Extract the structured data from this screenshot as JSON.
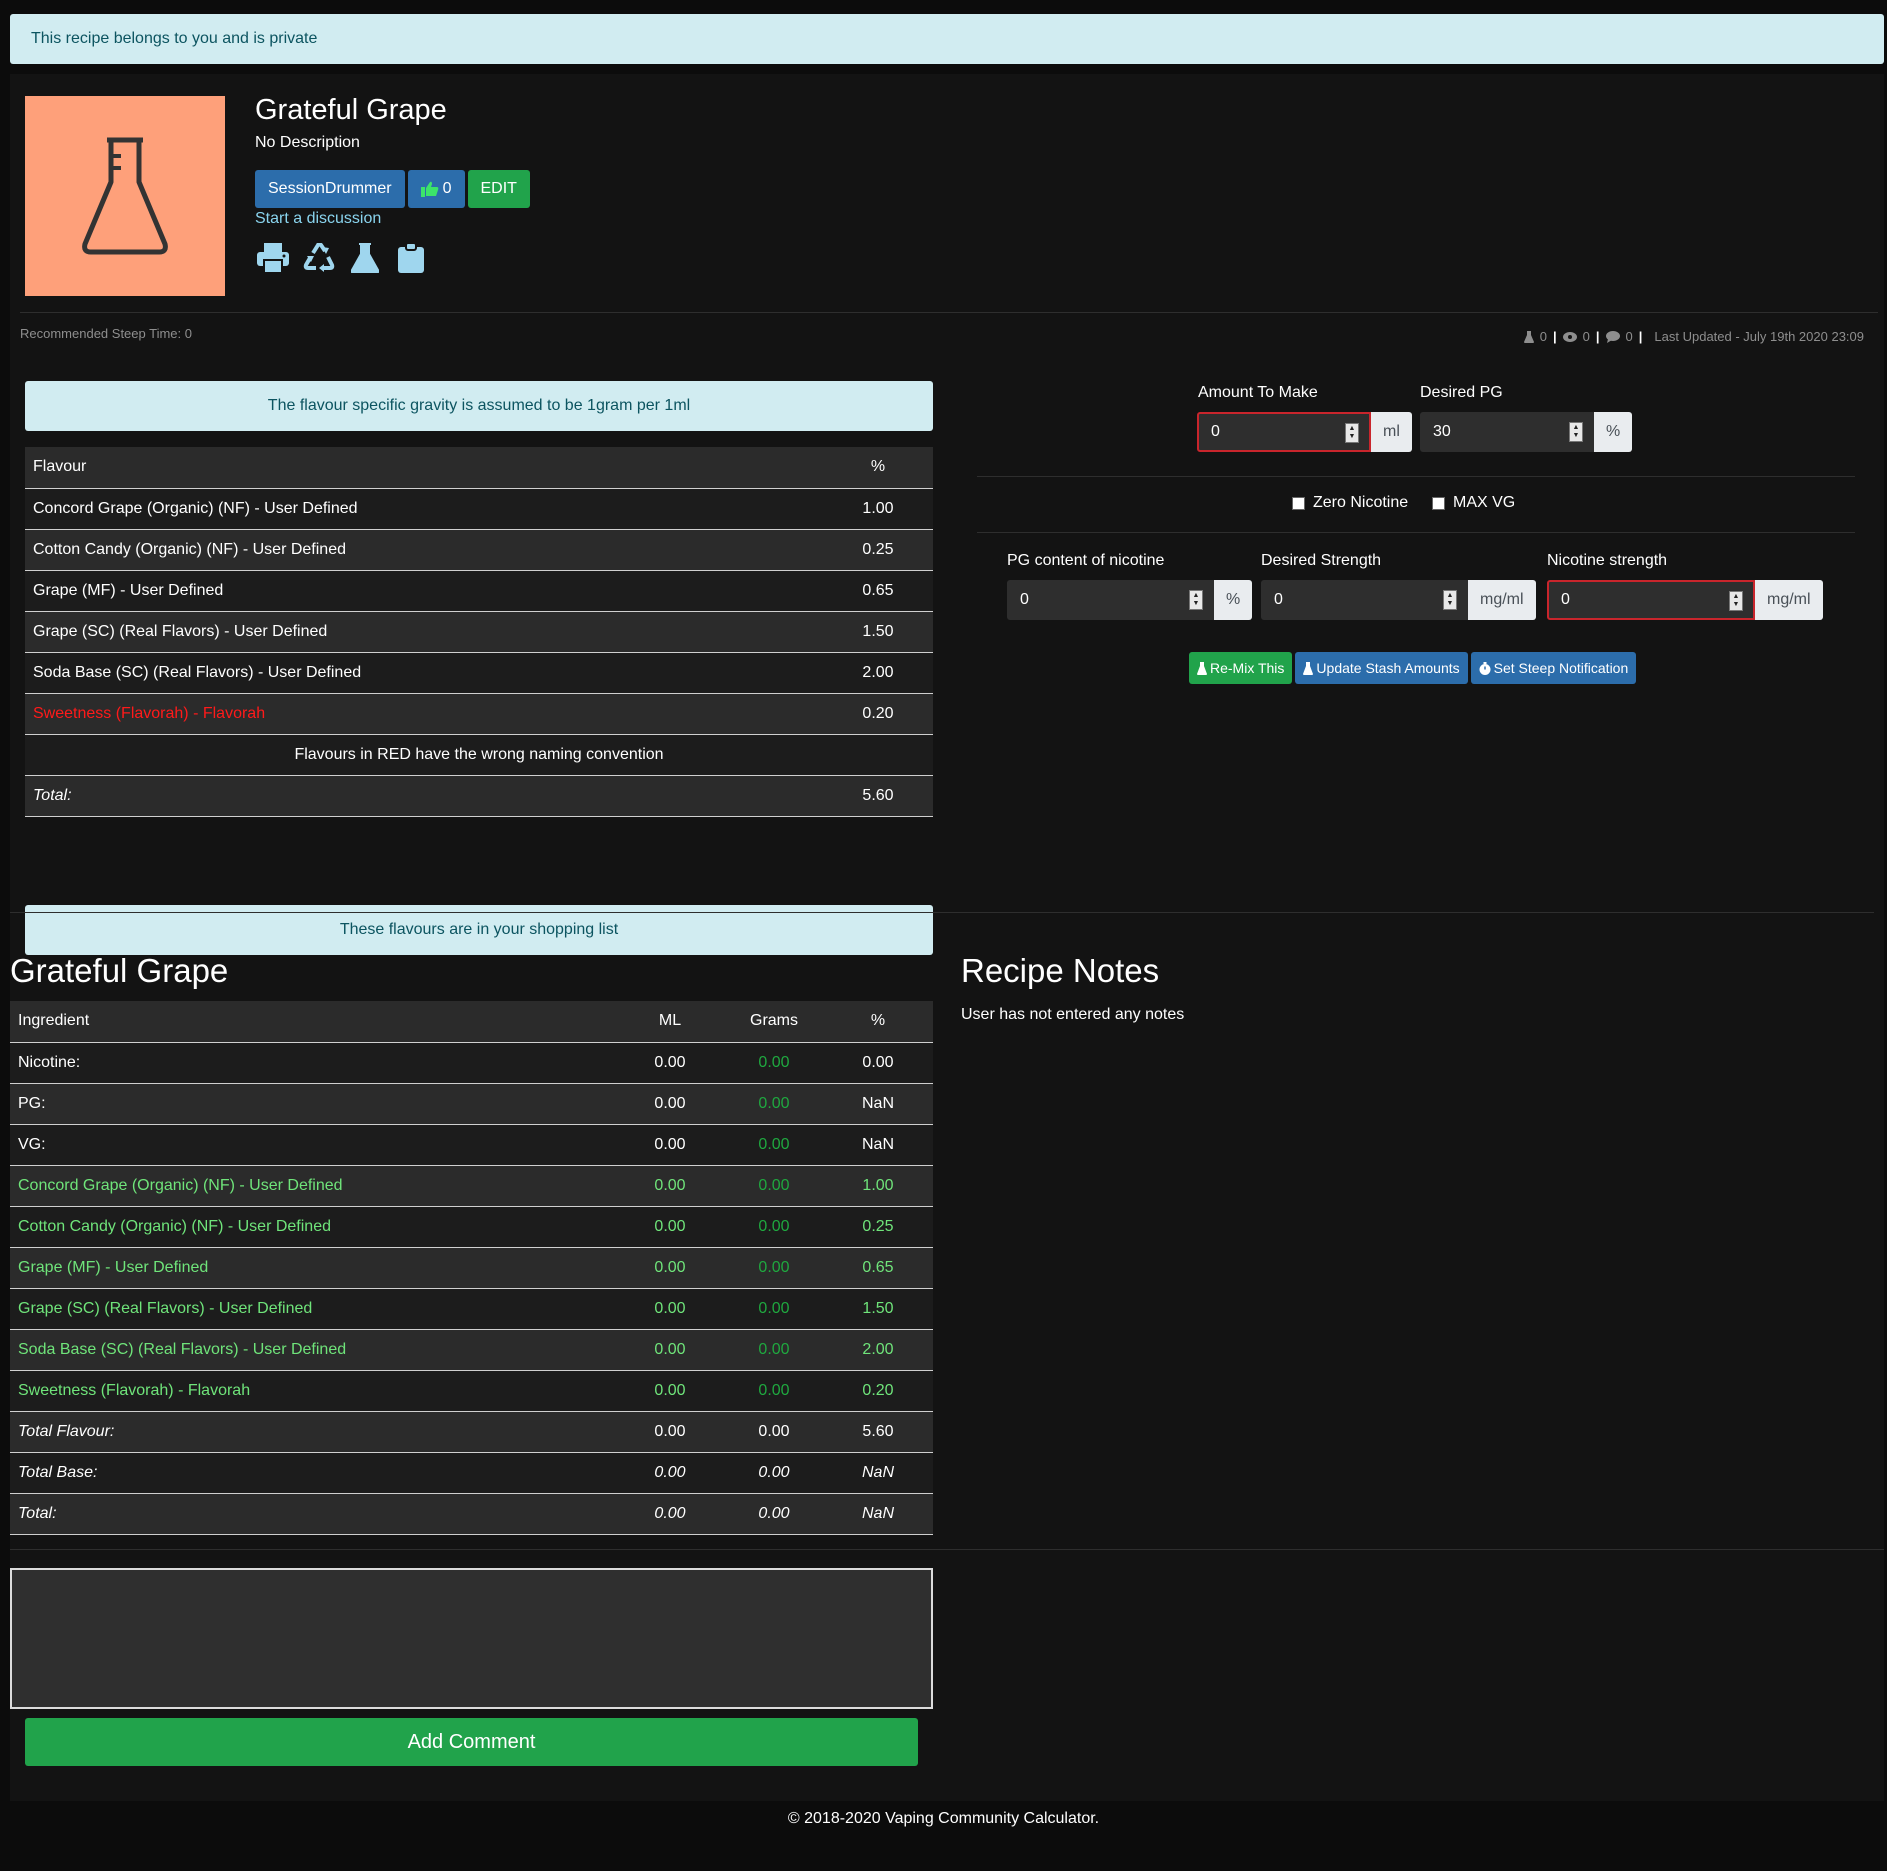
{
  "privacy_notice": "This recipe belongs to you and is private",
  "recipe": {
    "title": "Grateful Grape",
    "description": "No Description",
    "author": "SessionDrummer",
    "likes": "0",
    "edit_label": "EDIT",
    "discussion_link": "Start a discussion",
    "steep_time": "Recommended Steep Time: 0",
    "stats": {
      "mixes": "0",
      "views": "0",
      "comments": "0",
      "last_updated": "Last Updated - July 19th 2020 23:09"
    }
  },
  "icons": {
    "thumbnail": "flask-icon",
    "tools": [
      "print-icon",
      "recycle-icon",
      "flask-icon",
      "clipboard-icon"
    ]
  },
  "gravity_notice": "The flavour specific gravity is assumed to be 1gram per 1ml",
  "flavour_table": {
    "headers": [
      "Flavour",
      "%"
    ],
    "rows": [
      {
        "name": "Concord Grape (Organic) (NF) - User Defined",
        "pct": "1.00",
        "wrong_name": false
      },
      {
        "name": "Cotton Candy (Organic) (NF) - User Defined",
        "pct": "0.25",
        "wrong_name": false
      },
      {
        "name": "Grape (MF) - User Defined",
        "pct": "0.65",
        "wrong_name": false
      },
      {
        "name": "Grape (SC) (Real Flavors) - User Defined",
        "pct": "1.50",
        "wrong_name": false
      },
      {
        "name": "Soda Base (SC) (Real Flavors) - User Defined",
        "pct": "2.00",
        "wrong_name": false
      },
      {
        "name": "Sweetness (Flavorah) - Flavorah",
        "pct": "0.20",
        "wrong_name": true
      }
    ],
    "naming_note": "Flavours in RED have the wrong naming convention",
    "total_label": "Total:",
    "total_value": "5.60"
  },
  "shopping_notice": "These flavours are in your shopping list",
  "calculator": {
    "amount": {
      "label": "Amount To Make",
      "value": "0",
      "unit": "ml"
    },
    "pg": {
      "label": "Desired PG",
      "value": "30",
      "unit": "%"
    },
    "zero_nicotine": "Zero Nicotine",
    "max_vg": "MAX VG",
    "pg_nicotine": {
      "label": "PG content of nicotine",
      "value": "0",
      "unit": "%"
    },
    "desired_strength": {
      "label": "Desired Strength",
      "value": "0",
      "unit": "mg/ml"
    },
    "nicotine_strength": {
      "label": "Nicotine strength",
      "value": "0",
      "unit": "mg/ml"
    },
    "remix_label": "Re-Mix This",
    "stash_label": "Update Stash Amounts",
    "steep_label": "Set Steep Notification"
  },
  "ingredient_table": {
    "title": "Grateful Grape",
    "headers": [
      "Ingredient",
      "ML",
      "Grams",
      "%"
    ],
    "base_rows": [
      {
        "name": "Nicotine:",
        "ml": "0.00",
        "grams": "0.00",
        "pct": "0.00"
      },
      {
        "name": "PG:",
        "ml": "0.00",
        "grams": "0.00",
        "pct": "NaN"
      },
      {
        "name": "VG:",
        "ml": "0.00",
        "grams": "0.00",
        "pct": "NaN"
      }
    ],
    "flavour_rows": [
      {
        "name": "Concord Grape (Organic) (NF) - User Defined",
        "ml": "0.00",
        "grams": "0.00",
        "pct": "1.00"
      },
      {
        "name": "Cotton Candy (Organic) (NF) - User Defined",
        "ml": "0.00",
        "grams": "0.00",
        "pct": "0.25"
      },
      {
        "name": "Grape (MF) - User Defined",
        "ml": "0.00",
        "grams": "0.00",
        "pct": "0.65"
      },
      {
        "name": "Grape (SC) (Real Flavors) - User Defined",
        "ml": "0.00",
        "grams": "0.00",
        "pct": "1.50"
      },
      {
        "name": "Soda Base (SC) (Real Flavors) - User Defined",
        "ml": "0.00",
        "grams": "0.00",
        "pct": "2.00"
      },
      {
        "name": "Sweetness (Flavorah) - Flavorah",
        "ml": "0.00",
        "grams": "0.00",
        "pct": "0.20"
      }
    ],
    "totals": [
      {
        "name": "Total Flavour:",
        "ml": "0.00",
        "grams": "0.00",
        "pct": "5.60"
      },
      {
        "name": "Total Base:",
        "ml": "0.00",
        "grams": "0.00",
        "pct": "NaN"
      },
      {
        "name": "Total:",
        "ml": "0.00",
        "grams": "0.00",
        "pct": "NaN"
      }
    ]
  },
  "notes": {
    "title": "Recipe Notes",
    "text": "User has not entered any notes"
  },
  "comment": {
    "button_label": "Add Comment"
  },
  "footer": "© 2018-2020 Vaping Community Calculator."
}
